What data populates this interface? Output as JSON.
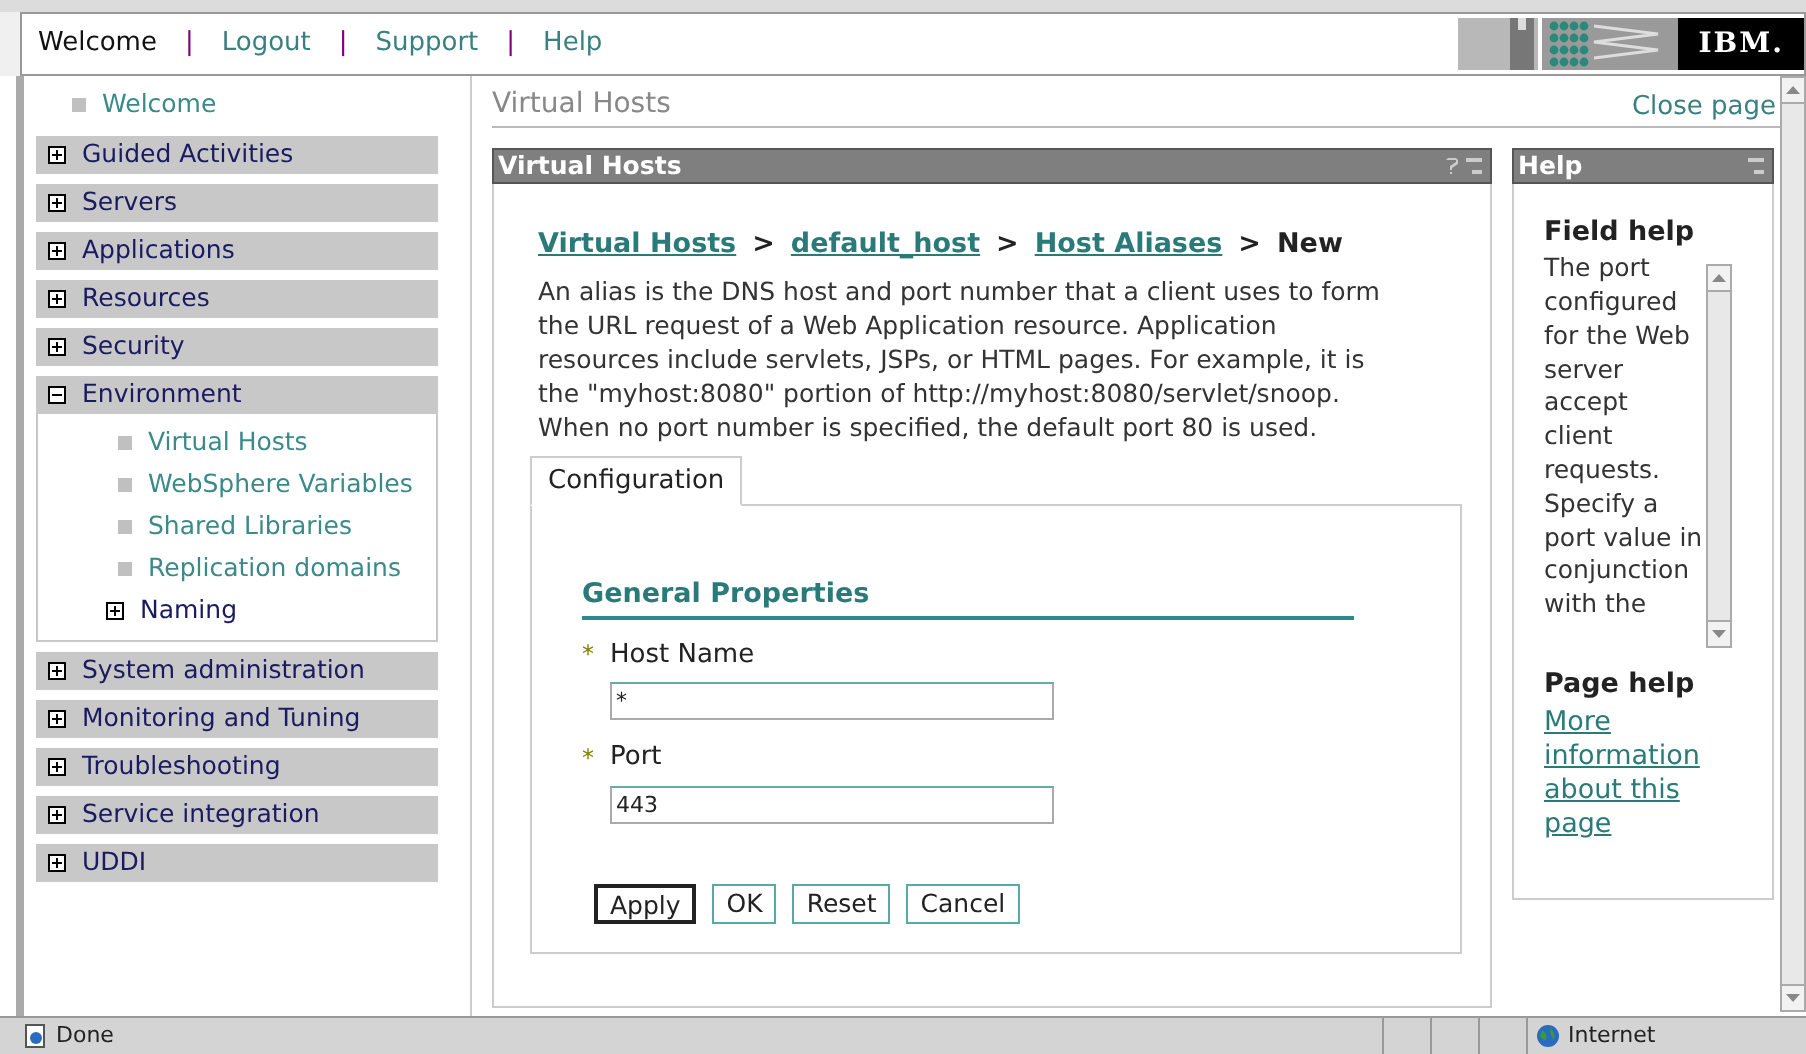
{
  "top_nav": [
    {
      "label": "Welcome",
      "selected": true
    },
    {
      "label": "Logout",
      "selected": false
    },
    {
      "label": "Support",
      "selected": false
    },
    {
      "label": "Help",
      "selected": false
    }
  ],
  "top_nav_separator": "|",
  "brand": "IBM.",
  "sidebar": {
    "items": [
      {
        "kind": "link",
        "label": "Welcome"
      },
      {
        "kind": "section",
        "label": "Guided Activities",
        "expanded": false
      },
      {
        "kind": "section",
        "label": "Servers",
        "expanded": false
      },
      {
        "kind": "section",
        "label": "Applications",
        "expanded": false
      },
      {
        "kind": "section",
        "label": "Resources",
        "expanded": false
      },
      {
        "kind": "section",
        "label": "Security",
        "expanded": false
      },
      {
        "kind": "section",
        "label": "Environment",
        "expanded": true,
        "children": [
          {
            "kind": "link",
            "label": "Virtual Hosts"
          },
          {
            "kind": "link",
            "label": "WebSphere Variables"
          },
          {
            "kind": "link",
            "label": "Shared Libraries"
          },
          {
            "kind": "link",
            "label": "Replication domains"
          },
          {
            "kind": "section",
            "label": "Naming",
            "expanded": false
          }
        ]
      },
      {
        "kind": "section",
        "label": "System administration",
        "expanded": false
      },
      {
        "kind": "section",
        "label": "Monitoring and Tuning",
        "expanded": false
      },
      {
        "kind": "section",
        "label": "Troubleshooting",
        "expanded": false
      },
      {
        "kind": "section",
        "label": "Service integration",
        "expanded": false
      },
      {
        "kind": "section",
        "label": "UDDI",
        "expanded": false
      }
    ]
  },
  "page_title": "Virtual Hosts",
  "close_link": "Close page",
  "panel": {
    "title": "Virtual Hosts",
    "breadcrumb": [
      {
        "label": "Virtual Hosts",
        "kind": "link"
      },
      {
        "label": "default_host",
        "kind": "link"
      },
      {
        "label": "Host Aliases",
        "kind": "link"
      },
      {
        "label": "New",
        "kind": "current"
      }
    ],
    "separator": ">",
    "description": "An alias is the DNS host and port number that a client uses to form the URL request of a Web Application resource. Application resources include servlets, JSPs, or HTML pages. For example, it is the \"myhost:8080\" portion of http://myhost:8080/servlet/snoop. When no port number is specified, the default port 80 is used.",
    "tabs": [
      {
        "label": "Configuration",
        "selected": true
      }
    ],
    "section_title": "General Properties",
    "fields": [
      {
        "label": "Host Name",
        "required": true,
        "value": "*"
      },
      {
        "label": "Port",
        "required": true,
        "value": "443"
      }
    ],
    "required_mark": "*",
    "buttons": [
      {
        "label": "Apply",
        "default": true
      },
      {
        "label": "OK",
        "default": false
      },
      {
        "label": "Reset",
        "default": false
      },
      {
        "label": "Cancel",
        "default": false
      }
    ]
  },
  "help": {
    "title": "Help",
    "field_help_title": "Field help",
    "field_help": "The port configured for the Web server accept client requests. Specify a port value in conjunction with the",
    "page_help_title": "Page help",
    "page_help_link": "More information about this page"
  },
  "status_bar": {
    "text": "Done",
    "zone": "Internet"
  }
}
